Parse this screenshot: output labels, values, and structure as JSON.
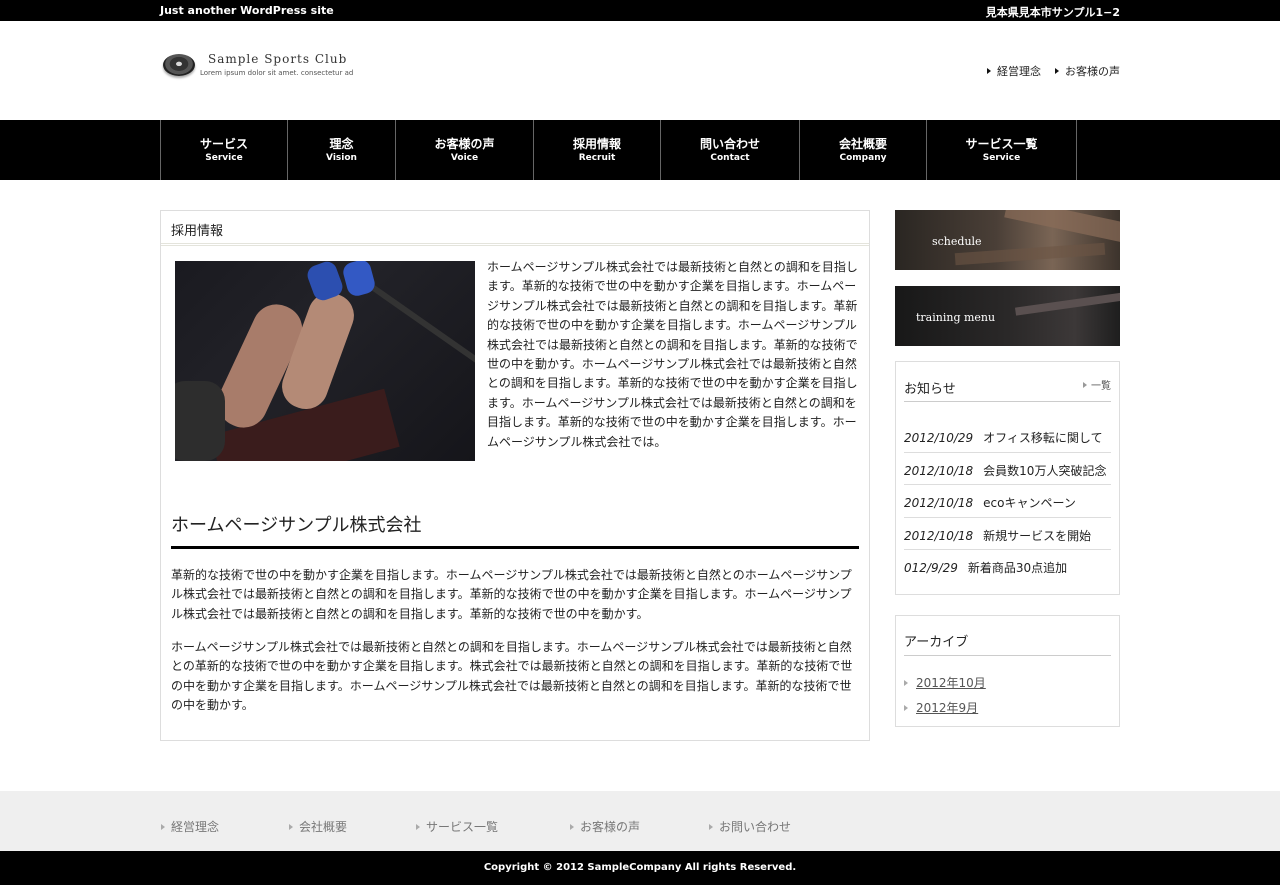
{
  "topbar": {
    "tagline": "Just another WordPress site",
    "address": "見本県見本市サンプル1−2"
  },
  "logo": {
    "name": "Sample Sports Club",
    "sub": "Lorem ipsum dolor sit amet. consectetur ad"
  },
  "header_links": [
    "経営理念",
    "お客様の声"
  ],
  "nav": [
    {
      "jp": "サービス",
      "en": "Service"
    },
    {
      "jp": "理念",
      "en": "Vision"
    },
    {
      "jp": "お客様の声",
      "en": "Voice"
    },
    {
      "jp": "採用情報",
      "en": "Recruit"
    },
    {
      "jp": "問い合わせ",
      "en": "Contact"
    },
    {
      "jp": "会社概要",
      "en": "Company"
    },
    {
      "jp": "サービス一覧",
      "en": "Service"
    }
  ],
  "main": {
    "title": "採用情報",
    "intro": "ホームページサンプル株式会社では最新技術と自然との調和を目指します。革新的な技術で世の中を動かす企業を目指します。ホームページサンプル株式会社では最新技術と自然との調和を目指します。革新的な技術で世の中を動かす企業を目指します。ホームページサンプル株式会社では最新技術と自然との調和を目指します。革新的な技術で世の中を動かす。ホームページサンプル株式会社では最新技術と自然との調和を目指します。革新的な技術で世の中を動かす企業を目指します。ホームページサンプル株式会社では最新技術と自然との調和を目指します。革新的な技術で世の中を動かす企業を目指します。ホームページサンプル株式会社では。",
    "heading": "ホームページサンプル株式会社",
    "para1": "革新的な技術で世の中を動かす企業を目指します。ホームページサンプル株式会社では最新技術と自然とのホームページサンプル株式会社では最新技術と自然との調和を目指します。革新的な技術で世の中を動かす企業を目指します。ホームページサンプル株式会社では最新技術と自然との調和を目指します。革新的な技術で世の中を動かす。",
    "para2": "ホームページサンプル株式会社では最新技術と自然との調和を目指します。ホームページサンプル株式会社では最新技術と自然との革新的な技術で世の中を動かす企業を目指します。株式会社では最新技術と自然との調和を目指します。革新的な技術で世の中を動かす企業を目指します。ホームページサンプル株式会社では最新技術と自然との調和を目指します。革新的な技術で世の中を動かす。"
  },
  "sidebar": {
    "banner1": "schedule",
    "banner2": "training menu",
    "news": {
      "title": "お知らせ",
      "more": "一覧",
      "items": [
        {
          "date": "2012/10/29",
          "text": "オフィス移転に関して"
        },
        {
          "date": "2012/10/18",
          "text": "会員数10万人突破記念"
        },
        {
          "date": "2012/10/18",
          "text": "ecoキャンペーン"
        },
        {
          "date": "2012/10/18",
          "text": "新規サービスを開始"
        },
        {
          "date": "012/9/29",
          "text": "新着商品30点追加"
        }
      ]
    },
    "archive": {
      "title": "アーカイブ",
      "items": [
        "2012年10月",
        "2012年9月"
      ]
    }
  },
  "footer": {
    "links": [
      "経営理念",
      "会社概要",
      "サービス一覧",
      "お客様の声",
      "お問い合わせ"
    ],
    "copyright": "Copyright © 2012 SampleCompany All rights Reserved."
  }
}
